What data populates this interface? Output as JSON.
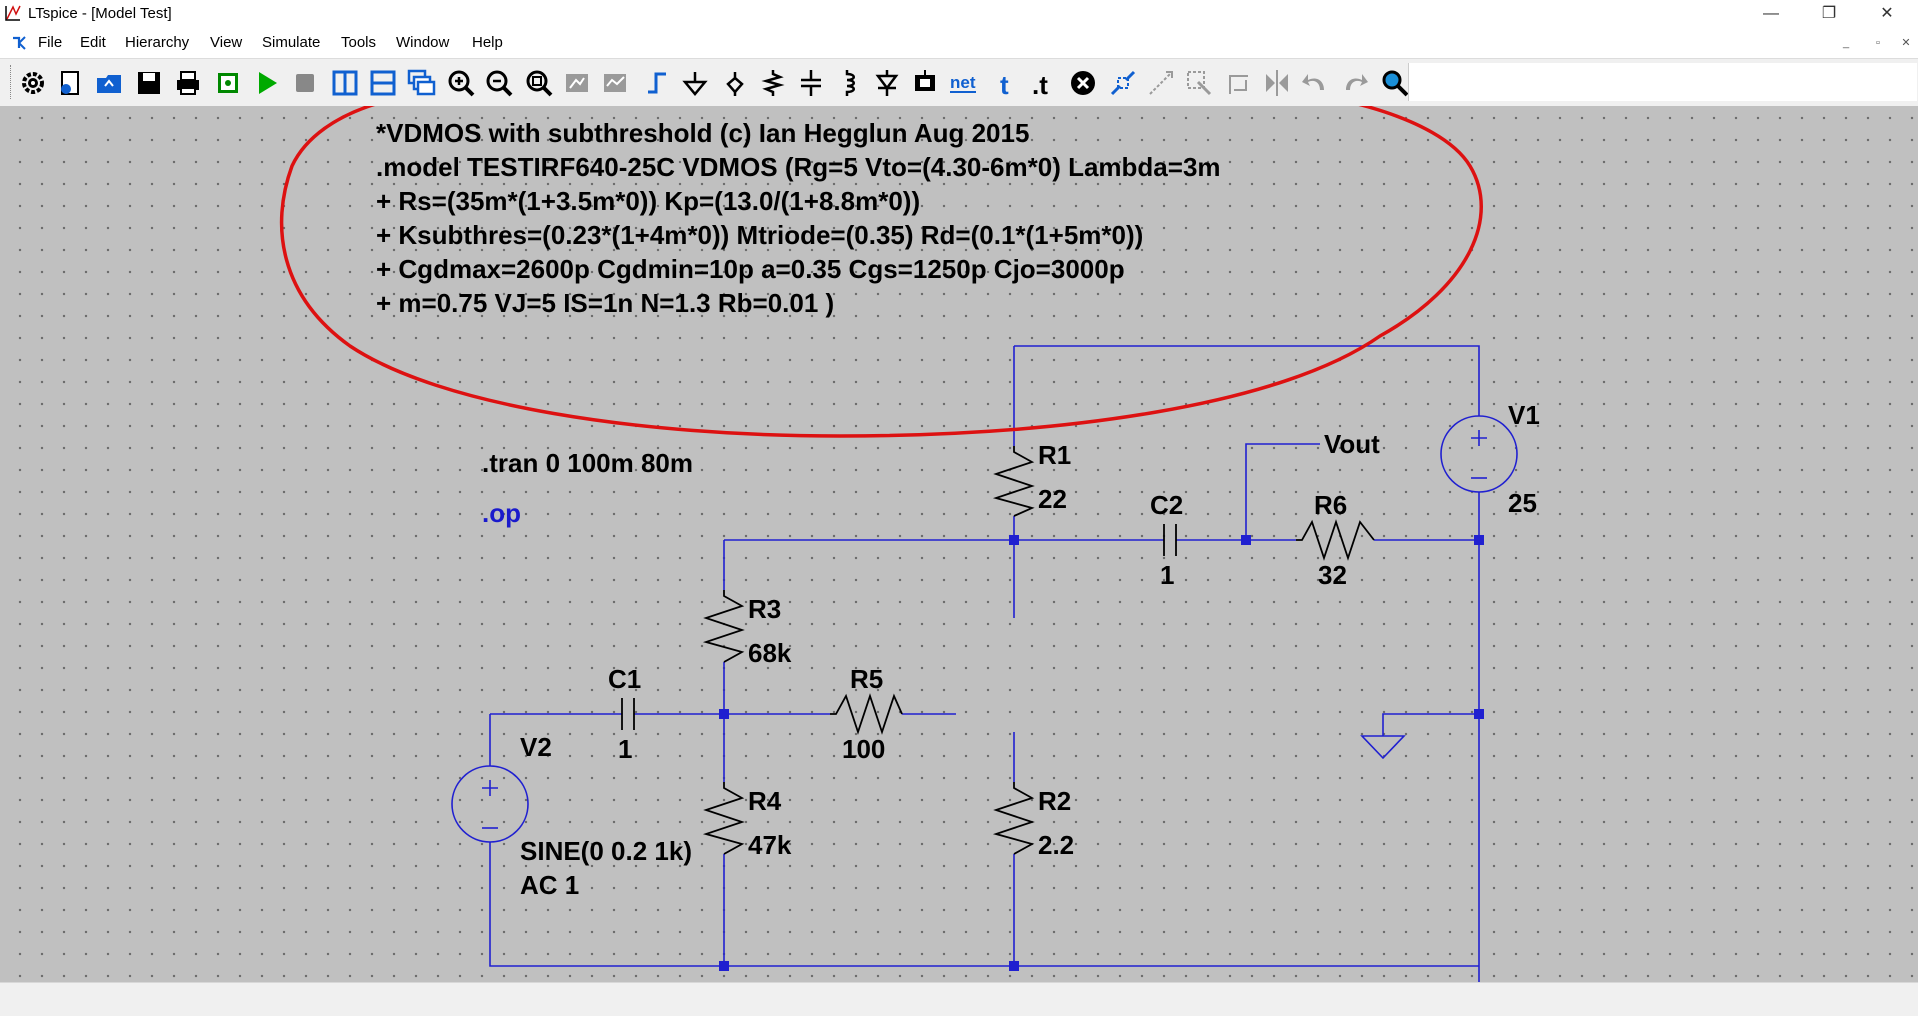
{
  "window": {
    "title": "LTspice - [Model Test]",
    "minimize": "—",
    "restore": "❐",
    "close": "✕"
  },
  "menu": [
    "File",
    "Edit",
    "Hierarchy",
    "View",
    "Simulate",
    "Tools",
    "Window",
    "Help"
  ],
  "mdi_controls": [
    "_",
    "▫",
    "✕"
  ],
  "toolbar": {
    "buttons": [
      {
        "name": "settings",
        "icon": "gear-icon",
        "color": "#000000"
      },
      {
        "name": "new-schematic",
        "icon": "new-file-icon",
        "color": "#1060d0"
      },
      {
        "name": "open",
        "icon": "open-folder-icon",
        "color": "#1060d0"
      },
      {
        "name": "save",
        "icon": "save-icon",
        "color": "#000000"
      },
      {
        "name": "print",
        "icon": "print-icon",
        "color": "#000000"
      },
      {
        "name": "control-panel",
        "icon": "circuit-board-icon",
        "color": "#008800"
      },
      {
        "name": "run",
        "icon": "play-icon",
        "color": "#00aa00"
      },
      {
        "name": "halt",
        "icon": "stop-icon",
        "color": "#888888"
      },
      {
        "name": "tile-vertical",
        "icon": "tile-vertical-icon",
        "color": "#1060d0"
      },
      {
        "name": "tile-horizontal",
        "icon": "tile-horizontal-icon",
        "color": "#1060d0"
      },
      {
        "name": "cascade",
        "icon": "cascade-icon",
        "color": "#1060d0"
      },
      {
        "name": "zoom-in",
        "icon": "zoom-in-icon",
        "color": "#000000"
      },
      {
        "name": "zoom-out",
        "icon": "zoom-out-icon",
        "color": "#000000"
      },
      {
        "name": "zoom-fit",
        "icon": "zoom-fit-icon",
        "color": "#000000"
      },
      {
        "name": "pan",
        "icon": "pan-icon",
        "color": "#9a9a9a"
      },
      {
        "name": "autorange",
        "icon": "autorange-icon",
        "color": "#9a9a9a"
      },
      {
        "name": "wire",
        "icon": "wire-icon",
        "color": "#1060d0"
      },
      {
        "name": "ground",
        "icon": "ground-icon",
        "color": "#000000"
      },
      {
        "name": "label-net",
        "icon": "net-label-icon",
        "color": "#000000"
      },
      {
        "name": "resistor",
        "icon": "resistor-icon",
        "color": "#000000"
      },
      {
        "name": "capacitor",
        "icon": "capacitor-icon",
        "color": "#000000"
      },
      {
        "name": "inductor",
        "icon": "inductor-icon",
        "color": "#000000"
      },
      {
        "name": "diode",
        "icon": "diode-icon",
        "color": "#000000"
      },
      {
        "name": "component",
        "icon": "component-icon",
        "color": "#000000"
      },
      {
        "name": "netlist",
        "icon": "net-text-icon",
        "color": "#1060d0",
        "text": "net"
      },
      {
        "name": "comment-text",
        "icon": "text-icon",
        "color": "#1060d0",
        "text": "t"
      },
      {
        "name": "spice-directive",
        "icon": "spice-directive-icon",
        "color": "#000000",
        "text": ".t"
      },
      {
        "name": "delete",
        "icon": "delete-icon",
        "color": "#000000"
      },
      {
        "name": "duplicate",
        "icon": "duplicate-icon",
        "color": "#1060d0"
      },
      {
        "name": "move",
        "icon": "move-icon",
        "color": "#9a9a9a"
      },
      {
        "name": "drag",
        "icon": "drag-icon",
        "color": "#9a9a9a"
      },
      {
        "name": "rotate",
        "icon": "rotate-icon",
        "color": "#9a9a9a"
      },
      {
        "name": "mirror",
        "icon": "mirror-icon",
        "color": "#9a9a9a"
      },
      {
        "name": "undo",
        "icon": "undo-icon",
        "color": "#9a9a9a"
      },
      {
        "name": "redo",
        "icon": "redo-icon",
        "color": "#9a9a9a"
      },
      {
        "name": "find",
        "icon": "find-icon",
        "color": "#000000"
      }
    ]
  },
  "schematic": {
    "model_lines": [
      "*VDMOS with subthreshold (c) Ian Hegglun Aug 2015",
      ".model TESTIRF640-25C VDMOS (Rg=5 Vto=(4.30-6m*0) Lambda=3m",
      "+ Rs=(35m*(1+3.5m*0)) Kp=(13.0/(1+8.8m*0))",
      "+ Ksubthres=(0.23*(1+4m*0)) Mtriode=(0.35) Rd=(0.1*(1+5m*0))",
      "+ Cgdmax=2600p Cgdmin=10p a=0.35 Cgs=1250p Cjo=3000p",
      "+ m=0.75 VJ=5 IS=1n N=1.3 Rb=0.01 )"
    ],
    "tran_directive": ".tran 0 100m 80m",
    "op_directive": ".op",
    "components": {
      "R1": {
        "name": "R1",
        "value": "22"
      },
      "R2": {
        "name": "R2",
        "value": "2.2"
      },
      "R3": {
        "name": "R3",
        "value": "68k"
      },
      "R4": {
        "name": "R4",
        "value": "47k"
      },
      "R5": {
        "name": "R5",
        "value": "100"
      },
      "R6": {
        "name": "R6",
        "value": "32"
      },
      "C1": {
        "name": "C1",
        "value": "1"
      },
      "C2": {
        "name": "C2",
        "value": "1"
      },
      "V1": {
        "name": "V1",
        "value": "25"
      },
      "V2": {
        "name": "V2",
        "value_line1": "SINE(0 0.2 1k)",
        "value_line2": "AC 1"
      }
    },
    "net_label": "Vout",
    "colors": {
      "wire": "#2020d0",
      "annotation": "#dd1111",
      "background": "#c0c0c0"
    }
  }
}
